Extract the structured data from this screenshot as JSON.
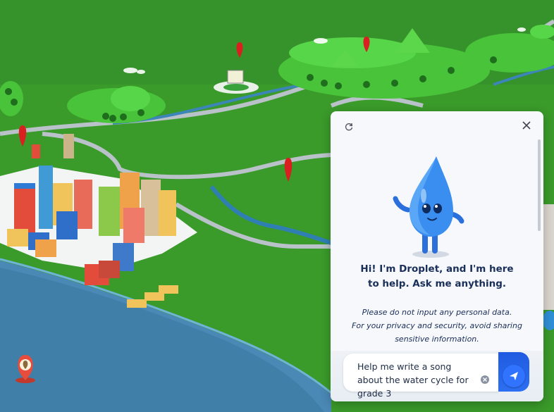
{
  "chat": {
    "greeting_line1": "Hi! I'm Droplet, and I'm here",
    "greeting_line2": "to help. Ask me anything.",
    "privacy_line1": "Please do not input any personal data.",
    "privacy_line2": "For your privacy and security, avoid sharing",
    "privacy_line3": "sensitive information.",
    "input_value": "Help me write a song about the water cycle for grade 3"
  },
  "icons": {
    "refresh": "refresh-icon",
    "close": "close-icon",
    "clear": "clear-input-icon",
    "send": "send-icon",
    "mascot": "droplet-mascot",
    "location_marker": "map-marker-icon"
  },
  "colors": {
    "grass": "#3a9a2a",
    "water": "#3f7fa8",
    "road": "#b9c2c9",
    "panel_bg": "#f6f8fb",
    "accent_blue": "#2f73ff",
    "text_navy": "#1a2e5a",
    "pin_red": "#d92020"
  }
}
